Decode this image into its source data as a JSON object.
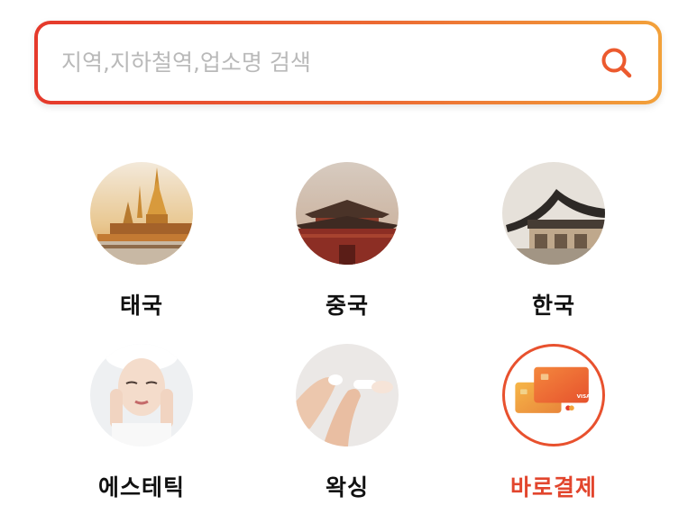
{
  "search": {
    "placeholder": "지역,지하철역,업소명 검색",
    "value": "",
    "icon": "search-icon"
  },
  "categories": [
    {
      "label": "태국",
      "icon": "thailand-temple-image"
    },
    {
      "label": "중국",
      "icon": "china-palace-image"
    },
    {
      "label": "한국",
      "icon": "korea-hanok-image"
    },
    {
      "label": "에스테틱",
      "icon": "aesthetic-face-image"
    },
    {
      "label": "왁싱",
      "icon": "waxing-legs-image"
    },
    {
      "label": "바로결제",
      "icon": "payment-cards-image",
      "accent_color": "#e2452d"
    }
  ],
  "colors": {
    "gradient_start": "#e5392b",
    "gradient_end": "#f2a13a",
    "accent": "#e2452d",
    "placeholder": "#b9b9b9"
  }
}
